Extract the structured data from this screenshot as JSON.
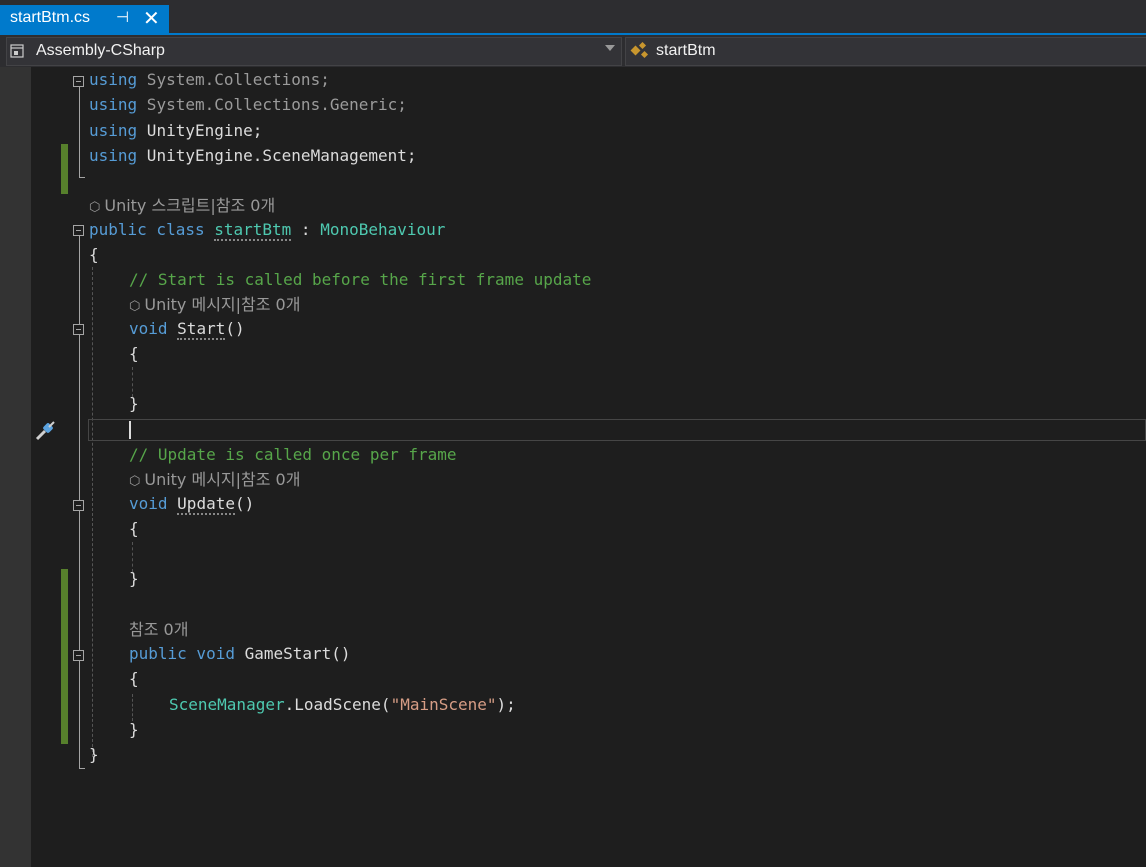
{
  "tab": {
    "title": "startBtm.cs",
    "pin_icon": "pin-icon",
    "close_icon": "close-icon"
  },
  "navbar": {
    "project": "Assembly-CSharp",
    "class": "startBtm"
  },
  "code": {
    "l1_kw": "using",
    "l1_rest": " System.Collections;",
    "l2_kw": "using",
    "l2_rest": " System.Collections.Generic;",
    "l3_kw": "using",
    "l3_rest": " UnityEngine;",
    "l4_kw": "using",
    "l4_rest": " UnityEngine.SceneManagement;",
    "hint_class": "Unity 스크립트|참조 0개",
    "class_kw": "public class",
    "class_name": "startBtm",
    "class_sep": " : ",
    "class_base": "MonoBehaviour",
    "brace_open": "{",
    "comment_start": "// Start is called before the first frame update",
    "hint_start": "Unity 메시지|참조 0개",
    "start_kw": "void",
    "start_name": "Start",
    "start_parens": "()",
    "start_open": "{",
    "start_close": "}",
    "comment_update": "// Update is called once per frame",
    "hint_update": "Unity 메시지|참조 0개",
    "update_kw": "void",
    "update_name": "Update",
    "update_parens": "()",
    "update_open": "{",
    "update_close": "}",
    "hint_gamestart": "참조 0개",
    "gs_kw": "public void",
    "gs_name": " GameStart()",
    "gs_open": "{",
    "gs_type": "SceneManager",
    "gs_call": ".LoadScene(",
    "gs_str": "\"MainScene\"",
    "gs_end": ");",
    "gs_close": "}",
    "brace_close": "}"
  }
}
